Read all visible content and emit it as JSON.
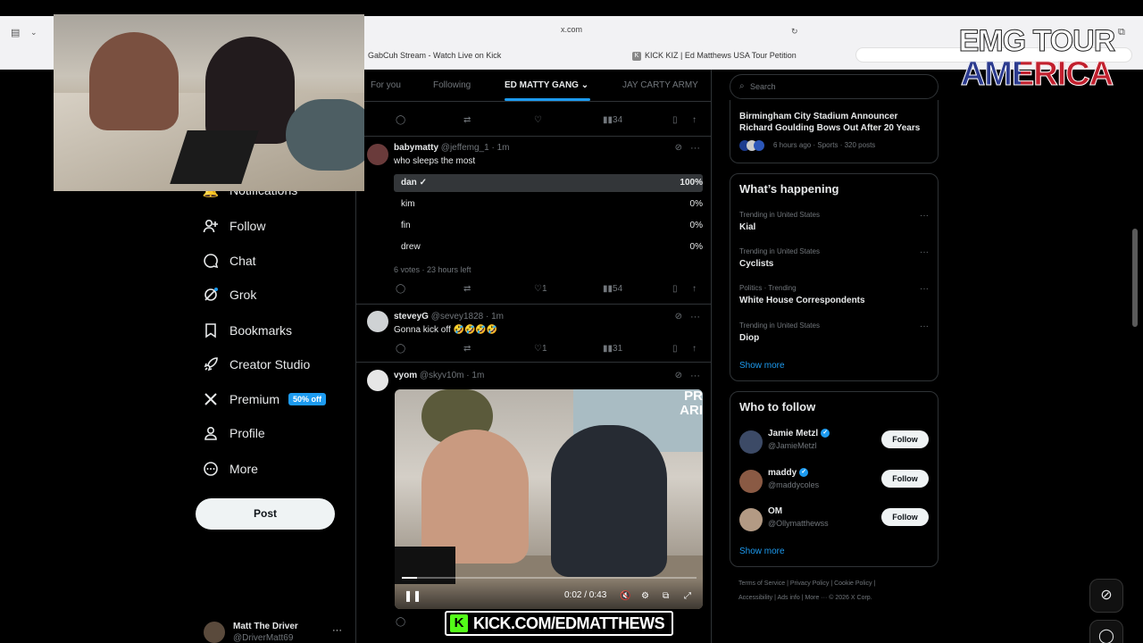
{
  "browser": {
    "url": "x.com",
    "tabs": [
      {
        "label": "GabCuh Stream - Watch Live on Kick"
      },
      {
        "label": "KICK KIZ | Ed Matthews USA Tour Petition"
      }
    ]
  },
  "overlays": {
    "emg_line1": "EMG TOUR",
    "emg_line2": "AMERICA",
    "kick_k": "K",
    "kick_url": "KICK.COM/EDMATTHEWS"
  },
  "nav": {
    "items": [
      {
        "label": "Notifications",
        "icon": "bell-icon"
      },
      {
        "label": "Follow",
        "icon": "person-add-icon"
      },
      {
        "label": "Chat",
        "icon": "chat-icon"
      },
      {
        "label": "Grok",
        "icon": "grok-icon"
      },
      {
        "label": "Bookmarks",
        "icon": "bookmark-icon"
      },
      {
        "label": "Creator Studio",
        "icon": "rocket-icon"
      },
      {
        "label": "Premium",
        "icon": "x-logo-icon",
        "badge": "50% off"
      },
      {
        "label": "Profile",
        "icon": "person-icon"
      },
      {
        "label": "More",
        "icon": "more-circle-icon"
      }
    ],
    "post_label": "Post",
    "account": {
      "name": "Matt The Driver",
      "handle": "@DriverMatt69"
    }
  },
  "feed": {
    "tabs": [
      "For you",
      "Following",
      "ED MATTY GANG",
      "JAY CARTY ARMY"
    ],
    "active_tab": "ED MATTY GANG",
    "top_actions": {
      "views": "34"
    },
    "tweets": [
      {
        "name": "babymatty",
        "meta": "@jeffemg_1 · 1m",
        "text": "who sleeps the most",
        "poll": [
          {
            "option": "dan",
            "percent": "100%",
            "fraction": 1.0,
            "winner": true
          },
          {
            "option": "kim",
            "percent": "0%",
            "fraction": 0
          },
          {
            "option": "fin",
            "percent": "0%",
            "fraction": 0
          },
          {
            "option": "drew",
            "percent": "0%",
            "fraction": 0
          }
        ],
        "votes": "6 votes · 23 hours left",
        "likes": "1",
        "views": "54"
      },
      {
        "name": "steveyG",
        "meta": "@sevey1828 · 1m",
        "text": "Gonna kick off 🤣🤣🤣🤣",
        "likes": "1",
        "views": "31"
      },
      {
        "name": "vyom",
        "meta": "@skyv10m · 1m",
        "video": {
          "time": "0:02 / 0:43",
          "progress": 0.05,
          "brand": "PR\nARI"
        }
      }
    ]
  },
  "right": {
    "search_placeholder": "Search",
    "top_story": {
      "title": "Birmingham City Stadium Announcer Richard Goulding Bows Out After 20 Years",
      "meta": "6 hours ago · Sports · 320 posts"
    },
    "happening_title": "What’s happening",
    "trends": [
      {
        "context": "Trending in United States",
        "name": "Kial"
      },
      {
        "context": "Trending in United States",
        "name": "Cyclists"
      },
      {
        "context": "Politics · Trending",
        "name": "White House Correspondents"
      },
      {
        "context": "Trending in United States",
        "name": "Diop"
      }
    ],
    "show_more": "Show more",
    "who_to_follow_title": "Who to follow",
    "follow_suggestions": [
      {
        "name": "Jamie Metzl",
        "handle": "@JamieMetzl",
        "verified": true
      },
      {
        "name": "maddy",
        "handle": "@maddycoles",
        "verified": true
      },
      {
        "name": "OM",
        "handle": "@Ollymatthewss",
        "verified": false
      }
    ],
    "follow_label": "Follow",
    "footer_line1": "Terms of Service  |  Privacy Policy  |  Cookie Policy  |",
    "footer_line2": "Accessibility  |  Ads info  |  More ···  © 2026 X Corp."
  }
}
